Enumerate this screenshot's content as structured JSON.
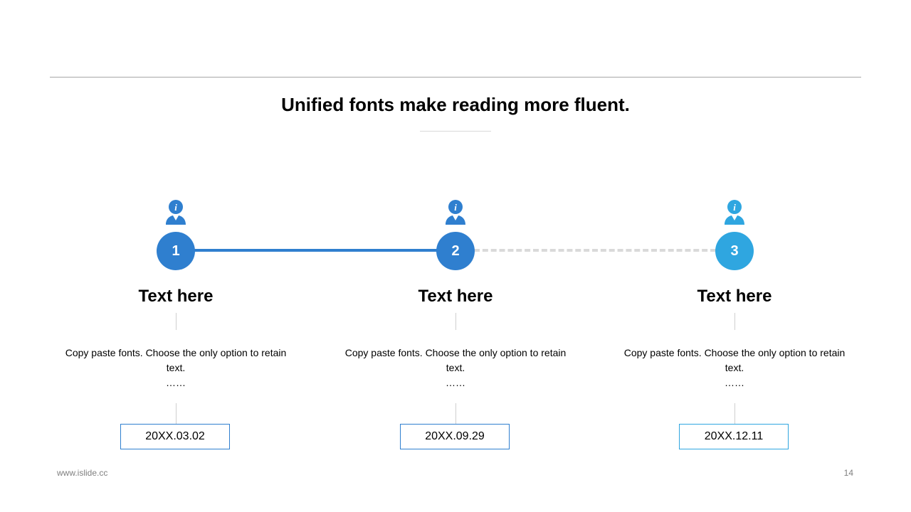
{
  "slide": {
    "title": "Unified fonts make reading more fluent.",
    "footer_url": "www.islide.cc",
    "page_number": "14"
  },
  "colors": {
    "accent": "#2f7fcf",
    "accent_light": "#2fa6e0",
    "connector_inactive": "#d9d9d9"
  },
  "steps": [
    {
      "number": "1",
      "heading": "Text here",
      "description": "Copy paste fonts. Choose the only option to retain text.",
      "ellipsis": "……",
      "date": "20XX.03.02",
      "icon": "user-info-icon"
    },
    {
      "number": "2",
      "heading": "Text here",
      "description": "Copy paste fonts. Choose the only option to retain text.",
      "ellipsis": "……",
      "date": "20XX.09.29",
      "icon": "user-info-icon"
    },
    {
      "number": "3",
      "heading": "Text here",
      "description": "Copy paste fonts. Choose the only option to retain text.",
      "ellipsis": "……",
      "date": "20XX.12.11",
      "icon": "user-info-icon"
    }
  ]
}
